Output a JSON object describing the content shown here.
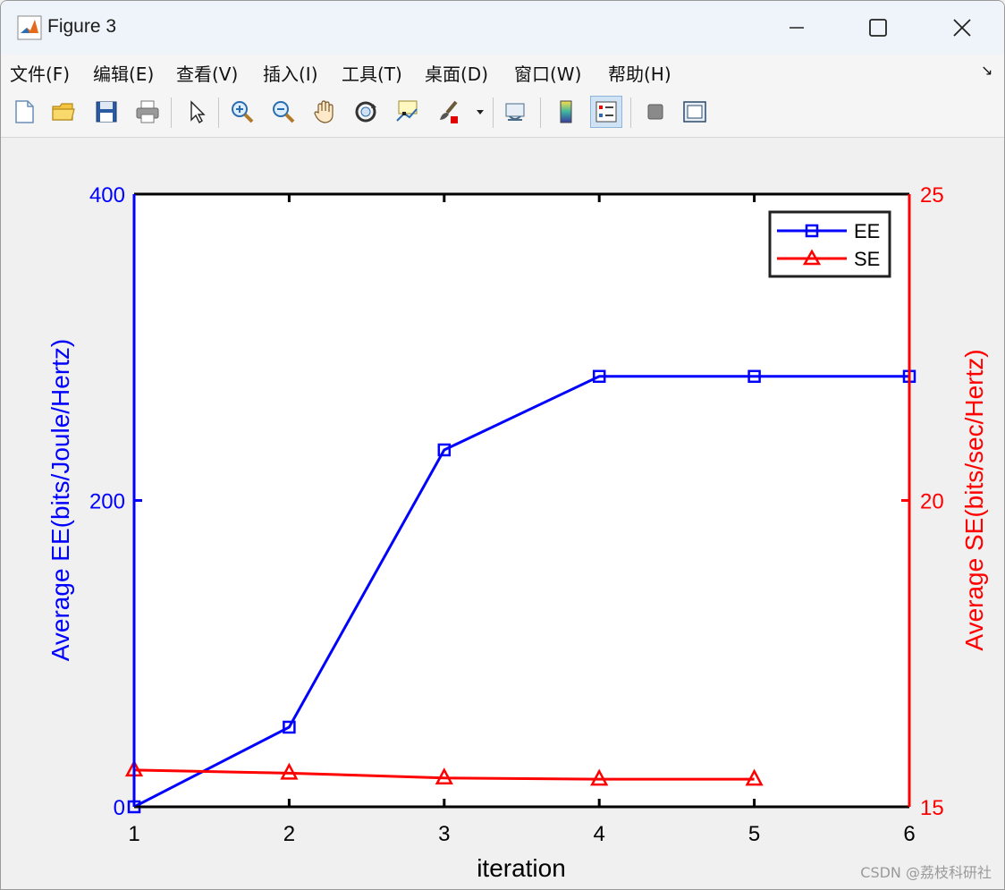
{
  "window": {
    "title": "Figure 3"
  },
  "menu": {
    "items": [
      "文件(F)",
      "编辑(E)",
      "查看(V)",
      "插入(I)",
      "工具(T)",
      "桌面(D)",
      "窗口(W)",
      "帮助(H)"
    ]
  },
  "toolbar": {
    "tools": [
      "new-figure",
      "open-file",
      "save-figure",
      "print-figure",
      "edit-plot",
      "zoom-in",
      "zoom-out",
      "pan",
      "rotate-3d",
      "data-cursor",
      "brush",
      "link-plot",
      "insert-colorbar",
      "insert-legend",
      "hide-plot-tools",
      "show-plot-tools"
    ]
  },
  "colors": {
    "ee": "#0000ff",
    "se": "#ff0000"
  },
  "watermark": "CSDN @荔枝科研社",
  "chart_data": {
    "type": "line",
    "xlabel": "iteration",
    "ylabel_left": "Average EE(bits/Joule/Hertz)",
    "ylabel_right": "Average SE(bits/sec/Hertz)",
    "xlim": [
      1,
      6
    ],
    "ylim_left": [
      0,
      400
    ],
    "ylim_right": [
      15,
      25
    ],
    "xticks": [
      1,
      2,
      3,
      4,
      5,
      6
    ],
    "yticks_left": [
      0,
      200,
      400
    ],
    "yticks_right": [
      15,
      20,
      25
    ],
    "legend_position": "top-right",
    "series": [
      {
        "name": "EE",
        "axis": "left",
        "color": "#0000ff",
        "marker": "square",
        "x": [
          1,
          2,
          3,
          4,
          5,
          6
        ],
        "values": [
          0,
          52,
          233,
          281,
          281,
          281
        ]
      },
      {
        "name": "SE",
        "axis": "right",
        "color": "#ff0000",
        "marker": "triangle",
        "x": [
          1,
          2,
          3,
          4,
          5
        ],
        "values": [
          15.6,
          15.55,
          15.47,
          15.45,
          15.45
        ]
      }
    ]
  }
}
